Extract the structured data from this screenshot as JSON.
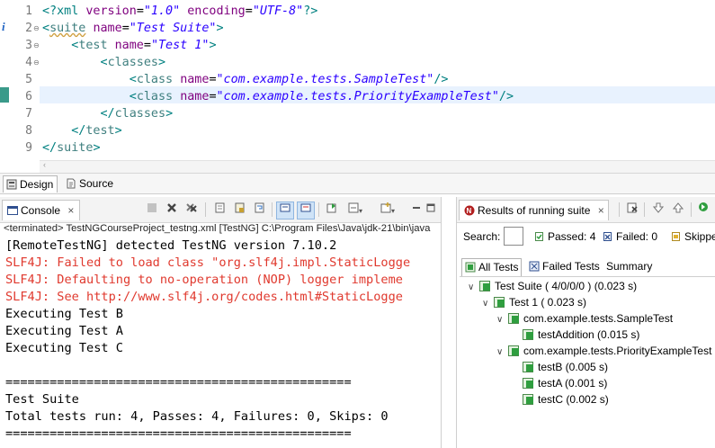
{
  "editor": {
    "line_numbers": [
      "1",
      "2",
      "3",
      "4",
      "5",
      "6",
      "7",
      "8",
      "9"
    ],
    "line1": {
      "pi_open": "<?xml ",
      "a1": "version",
      "eq": "=",
      "v1": "\"1.0\"",
      "a2": "encoding",
      "v2": "\"UTF-8\"",
      "pi_close": "?>"
    },
    "line2": {
      "open": "<",
      "tag": "suite",
      "attr": "name",
      "eq": "=",
      "val": "\"Test Suite\"",
      "close": ">"
    },
    "line3": {
      "open": "<",
      "tag": "test",
      "attr": "name",
      "eq": "=",
      "val": "\"Test 1\"",
      "close": ">"
    },
    "line4": {
      "open": "<",
      "tag": "classes",
      "close": ">"
    },
    "line5": {
      "open": "<",
      "tag": "class",
      "attr": "name",
      "eq": "=",
      "val": "\"com.example.tests.SampleTest\"",
      "close": "/>"
    },
    "line6": {
      "open": "<",
      "tag": "class",
      "attr": "name",
      "eq": "=",
      "val": "\"com.example.tests.PriorityExampleTest\"",
      "close": "/>"
    },
    "line7": {
      "open": "</",
      "tag": "classes",
      "close": ">"
    },
    "line8": {
      "open": "</",
      "tag": "test",
      "close": ">"
    },
    "line9": {
      "open": "</",
      "tag": "suite",
      "close": ">"
    },
    "scroll_glyph": "‹"
  },
  "editor_tabs": {
    "design": "Design",
    "source": "Source"
  },
  "console": {
    "tab_label": "Console",
    "close_glyph": "×",
    "terminated": "<terminated> TestNGCourseProject_testng.xml [TestNG] C:\\Program Files\\Java\\jdk-21\\bin\\java",
    "lines": [
      {
        "text": "[RemoteTestNG] detected TestNG version 7.10.2",
        "err": false
      },
      {
        "text": "SLF4J: Failed to load class \"org.slf4j.impl.StaticLogge",
        "err": true
      },
      {
        "text": "SLF4J: Defaulting to no-operation (NOP) logger impleme",
        "err": true
      },
      {
        "text": "SLF4J: See http://www.slf4j.org/codes.html#StaticLogge",
        "err": true
      },
      {
        "text": "Executing Test B",
        "err": false
      },
      {
        "text": "Executing Test A",
        "err": false
      },
      {
        "text": "Executing Test C",
        "err": false
      },
      {
        "text": "",
        "err": false
      },
      {
        "text": "===============================================",
        "err": false
      },
      {
        "text": "Test Suite",
        "err": false
      },
      {
        "text": "Total tests run: 4, Passes: 4, Failures: 0, Skips: 0",
        "err": false
      },
      {
        "text": "===============================================",
        "err": false
      }
    ]
  },
  "testng": {
    "title": "Results of running suite",
    "close_glyph": "×",
    "search_label": "Search:",
    "passed": "Passed: 4",
    "failed": "Failed: 0",
    "skipped": "Skippe",
    "tabs": {
      "all": "All Tests",
      "failed": "Failed Tests",
      "summary": "Summary"
    },
    "tree": [
      {
        "label": "Test Suite ( 4/0/0/0 ) (0.023 s)",
        "depth": 0,
        "expanded": true
      },
      {
        "label": "Test 1 ( 0.023 s)",
        "depth": 1,
        "expanded": true
      },
      {
        "label": "com.example.tests.SampleTest",
        "depth": 2,
        "expanded": true
      },
      {
        "label": "testAddition  (0.015 s)",
        "depth": 3,
        "expanded": null
      },
      {
        "label": "com.example.tests.PriorityExampleTest",
        "depth": 2,
        "expanded": true
      },
      {
        "label": "testB  (0.005 s)",
        "depth": 3,
        "expanded": null
      },
      {
        "label": "testA  (0.001 s)",
        "depth": 3,
        "expanded": null
      },
      {
        "label": "testC  (0.002 s)",
        "depth": 3,
        "expanded": null
      }
    ]
  },
  "colors": {
    "tag": "#3f7f7f",
    "attr": "#7f007f",
    "value": "#2a00ff",
    "error_text": "#e0392e",
    "pass": "#2f9e3f"
  }
}
